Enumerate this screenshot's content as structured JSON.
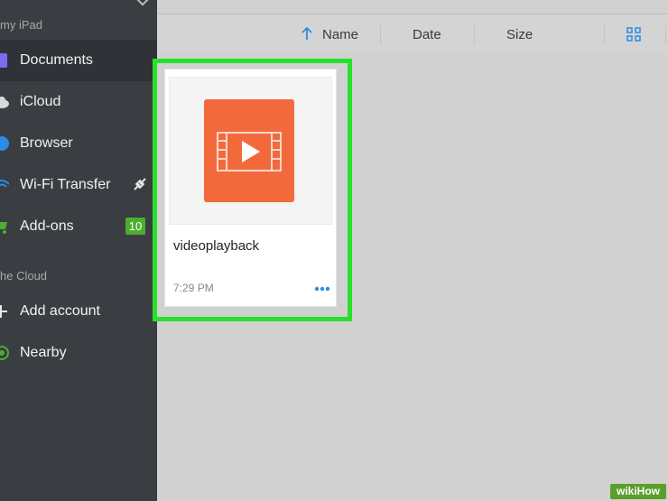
{
  "sidebar": {
    "section_device": "my iPad",
    "section_cloud": "he Cloud",
    "items": [
      {
        "label": "Documents"
      },
      {
        "label": "iCloud"
      },
      {
        "label": "Browser"
      },
      {
        "label": "Wi-Fi Transfer"
      },
      {
        "label": "Add-ons",
        "badge": "10"
      },
      {
        "label": "Add account"
      },
      {
        "label": "Nearby"
      }
    ]
  },
  "toolbar": {
    "sort_name": "Name",
    "sort_date": "Date",
    "sort_size": "Size"
  },
  "files": [
    {
      "name": "videoplayback",
      "time": "7:29 PM",
      "icon": "video-file-icon"
    }
  ],
  "watermark": {
    "text": "wikiHow"
  },
  "colors": {
    "sidebar_bg": "#3a3d42",
    "highlight": "#27e02a",
    "file_icon": "#f26a3c",
    "accent": "#2a8de8",
    "badge": "#4cae2f"
  }
}
